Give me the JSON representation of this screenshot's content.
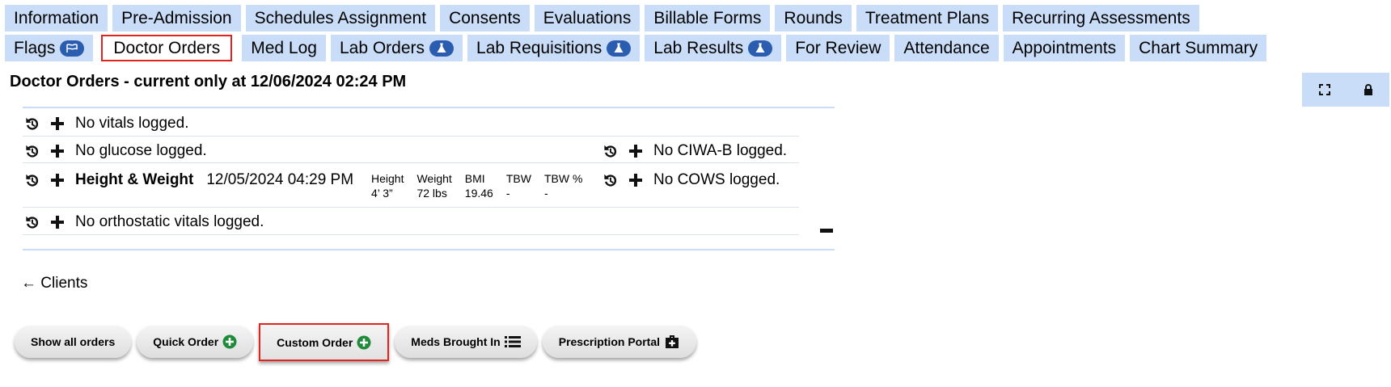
{
  "tabs_row1": [
    {
      "label": "Information"
    },
    {
      "label": "Pre-Admission"
    },
    {
      "label": "Schedules Assignment"
    },
    {
      "label": "Consents"
    },
    {
      "label": "Evaluations"
    },
    {
      "label": "Billable Forms"
    },
    {
      "label": "Rounds"
    },
    {
      "label": "Treatment Plans"
    },
    {
      "label": "Recurring Assessments"
    }
  ],
  "tabs_row2": [
    {
      "label": "Flags",
      "icon": "flag-icon"
    },
    {
      "label": "Doctor Orders",
      "active": true
    },
    {
      "label": "Med Log"
    },
    {
      "label": "Lab Orders",
      "icon": "flask-icon"
    },
    {
      "label": "Lab Requisitions",
      "icon": "flask-icon"
    },
    {
      "label": "Lab Results",
      "icon": "flask-icon"
    },
    {
      "label": "For Review"
    },
    {
      "label": "Attendance"
    },
    {
      "label": "Appointments"
    },
    {
      "label": "Chart Summary"
    }
  ],
  "page_title": "Doctor Orders - current only at 12/06/2024 02:24 PM",
  "vitals": {
    "vitals_text": "No vitals logged.",
    "glucose_text": "No glucose logged.",
    "ciwa_text": "No CIWA-B logged.",
    "height_weight_label": "Height & Weight",
    "height_weight_date": "12/05/2024 04:29 PM",
    "metrics": [
      {
        "label": "Height",
        "value": "4’ 3”"
      },
      {
        "label": "Weight",
        "value": "72 lbs"
      },
      {
        "label": "BMI",
        "value": "19.46"
      },
      {
        "label": "TBW",
        "value": "-"
      },
      {
        "label": "TBW %",
        "value": "-"
      }
    ],
    "cows_text": "No COWS logged.",
    "orthostatic_text": "No orthostatic vitals logged."
  },
  "back_link": "← Clients",
  "buttons": {
    "show_all": "Show all orders",
    "quick_order": "Quick Order",
    "custom_order": "Custom Order",
    "meds_brought_in": "Meds Brought In",
    "prescription_portal": "Prescription Portal"
  },
  "colors": {
    "tab_bg": "#c9ddf8",
    "badge": "#2a5db0",
    "highlight": "#e0241f",
    "add_green": "#1f8a3a"
  }
}
